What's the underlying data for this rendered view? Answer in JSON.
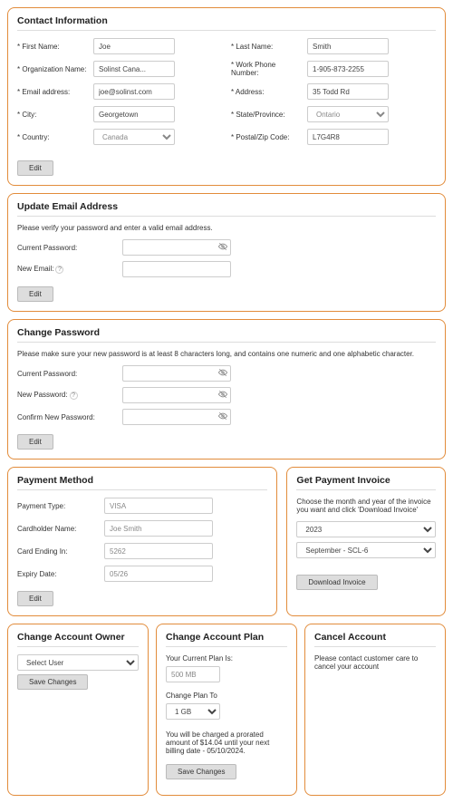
{
  "contact": {
    "heading": "Contact Information",
    "labels": {
      "firstName": "* First Name:",
      "lastName": "* Last Name:",
      "orgName": "* Organization Name:",
      "workPhone": "* Work Phone Number:",
      "email": "* Email address:",
      "address": "* Address:",
      "city": "* City:",
      "state": "* State/Province:",
      "country": "* Country:",
      "postal": "* Postal/Zip Code:"
    },
    "values": {
      "firstName": "Joe",
      "lastName": "Smith",
      "orgName": "Solinst Cana...",
      "workPhone": "1-905-873-2255",
      "email": "joe@solinst.com",
      "address": "35 Todd Rd",
      "city": "Georgetown",
      "state": "Ontario",
      "country": "Canada",
      "postal": "L7G4R8"
    },
    "editBtn": "Edit"
  },
  "updateEmail": {
    "heading": "Update Email Address",
    "helper": "Please verify your password and enter a valid email address.",
    "labels": {
      "currentPw": "Current Password:",
      "newEmail": "New Email:"
    },
    "editBtn": "Edit"
  },
  "changePw": {
    "heading": "Change Password",
    "helper": "Please make sure your new password is at least 8 characters long, and contains one numeric and one alphabetic character.",
    "labels": {
      "currentPw": "Current Password:",
      "newPw": "New Password:",
      "confirmPw": "Confirm New Password:"
    },
    "editBtn": "Edit"
  },
  "payment": {
    "heading": "Payment Method",
    "labels": {
      "type": "Payment Type:",
      "name": "Cardholder Name:",
      "ending": "Card Ending In:",
      "expiry": "Expiry Date:"
    },
    "values": {
      "type": "VISA",
      "name": "Joe Smith",
      "ending": "5262",
      "expiry": "05/26"
    },
    "editBtn": "Edit"
  },
  "invoice": {
    "heading": "Get Payment Invoice",
    "helper": "Choose the month and year of the invoice you want and click 'Download Invoice'",
    "yearSelected": "2023",
    "monthSelected": "September - SCL-6",
    "downloadBtn": "Download Invoice"
  },
  "owner": {
    "heading": "Change Account Owner",
    "selectPlaceholder": "Select User",
    "saveBtn": "Save Changes"
  },
  "plan": {
    "heading": "Change Account Plan",
    "currentLabel": "Your Current Plan Is:",
    "currentValue": "500 MB",
    "changeLabel": "Change Plan To",
    "changeSelected": "1 GB",
    "prorateMsg": "You will be charged a prorated amount of $14.04 until your next billing date - 05/10/2024.",
    "saveBtn": "Save Changes"
  },
  "cancel": {
    "heading": "Cancel Account",
    "msg": "Please contact customer care to cancel your account"
  }
}
